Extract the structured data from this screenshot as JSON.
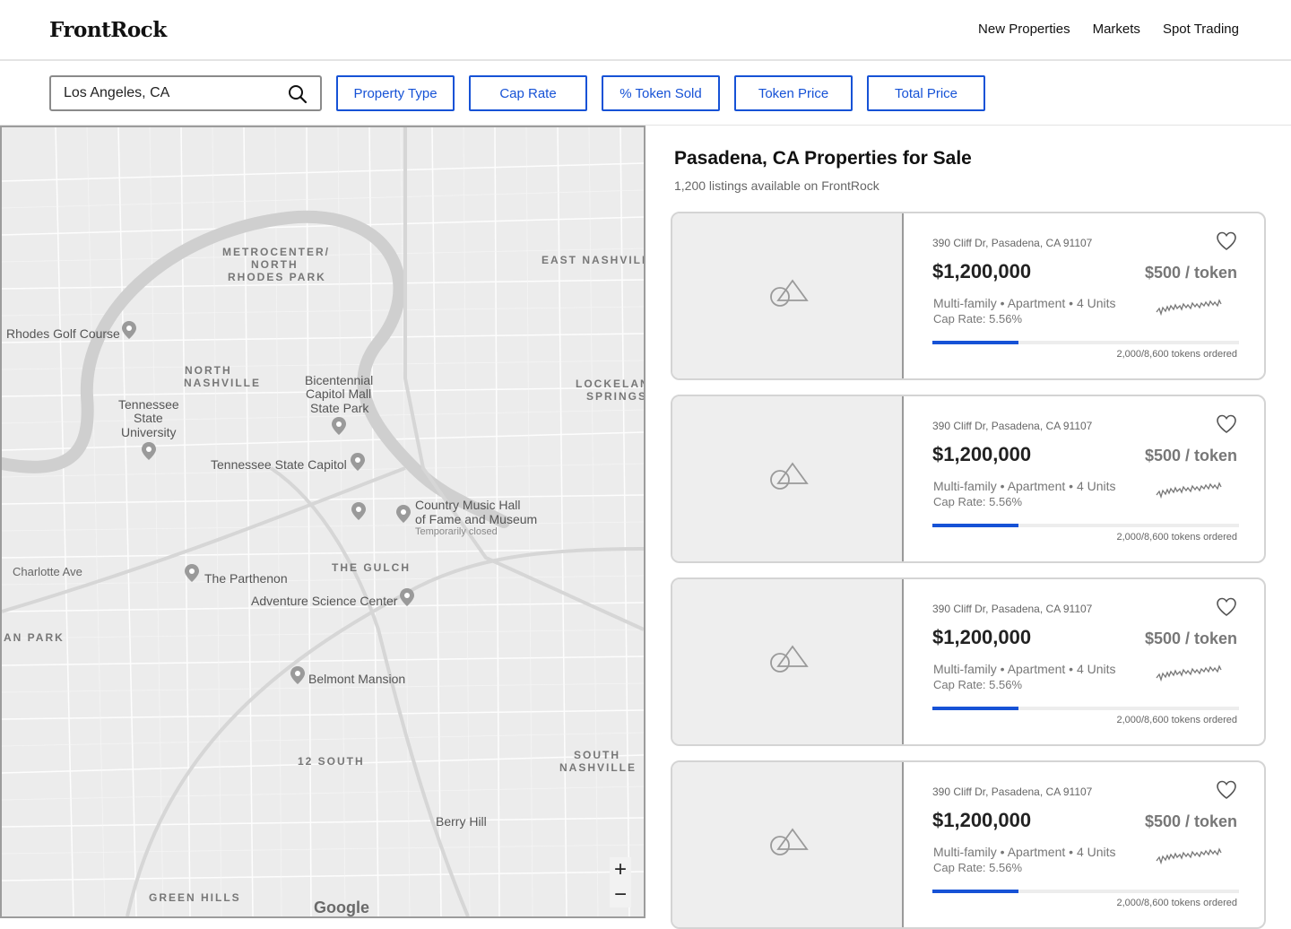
{
  "header": {
    "logo": "FrontRock",
    "nav": [
      "New Properties",
      "Markets",
      "Spot Trading"
    ]
  },
  "filters": {
    "search_value": "Los Angeles, CA",
    "buttons": [
      "Property Type",
      "Cap Rate",
      "% Token Sold",
      "Token Price",
      "Total Price"
    ]
  },
  "map": {
    "areas": [
      "METROCENTER/",
      "NORTH",
      "RHODES PARK",
      "NORTH",
      "NASHVILLE",
      "EAST NASHVILL",
      "LOCKELAN",
      "SPRINGS",
      "THE GULCH",
      "12 SOUTH",
      "SOUTH",
      "NASHVILLE",
      "GREEN HILLS",
      "AN PARK"
    ],
    "pois": [
      "Rhodes Golf Course",
      "Tennessee",
      "State",
      "University",
      "Bicentennial",
      "Capitol Mall",
      "State Park",
      "Tennessee State Capitol",
      "Country Music Hall",
      "of Fame and Museum",
      "The Parthenon",
      "Adventure Science Center",
      "Belmont Mansion",
      "Berry Hill",
      "Charlotte Ave"
    ],
    "note": "Temporarily closed",
    "attribution": "Google",
    "zoom_in": "+",
    "zoom_out": "−"
  },
  "results": {
    "title": "Pasadena, CA Properties for Sale",
    "subtitle": "1,200 listings available on FrontRock",
    "listings": [
      {
        "address": "390 Cliff Dr, Pasadena, CA 91107",
        "price": "$1,200,000",
        "token_price": "$500 / token",
        "meta": "Multi-family • Apartment • 4 Units",
        "cap_rate": "Cap Rate: 5.56%",
        "ordered": "2,000/8,600 tokens ordered",
        "progress": 0.28
      },
      {
        "address": "390 Cliff Dr, Pasadena, CA 91107",
        "price": "$1,200,000",
        "token_price": "$500 / token",
        "meta": "Multi-family • Apartment • 4 Units",
        "cap_rate": "Cap Rate: 5.56%",
        "ordered": "2,000/8,600 tokens ordered",
        "progress": 0.28
      },
      {
        "address": "390 Cliff Dr, Pasadena, CA 91107",
        "price": "$1,200,000",
        "token_price": "$500 / token",
        "meta": "Multi-family • Apartment • 4 Units",
        "cap_rate": "Cap Rate: 5.56%",
        "ordered": "2,000/8,600 tokens ordered",
        "progress": 0.28
      },
      {
        "address": "390 Cliff Dr, Pasadena, CA 91107",
        "price": "$1,200,000",
        "token_price": "$500 / token",
        "meta": "Multi-family • Apartment • 4 Units",
        "cap_rate": "Cap Rate: 5.56%",
        "ordered": "2,000/8,600 tokens ordered",
        "progress": 0.28
      }
    ]
  },
  "colors": {
    "accent": "#1652d6",
    "map_bg": "#ececec",
    "thumb_bg": "#eeeeee"
  },
  "icons": [
    "search-icon",
    "heart-icon",
    "image-placeholder-icon",
    "sparkline-icon",
    "plus-icon",
    "minus-icon"
  ]
}
